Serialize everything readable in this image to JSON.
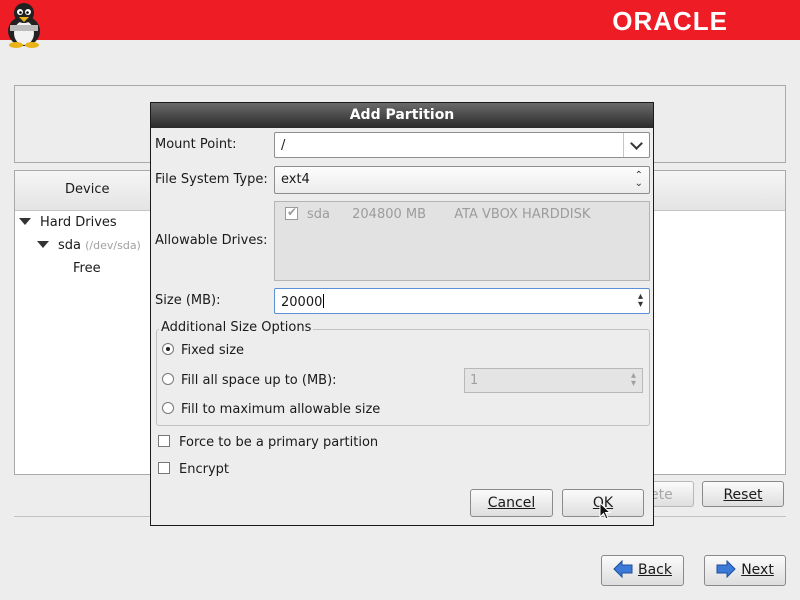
{
  "header": {
    "brand": "ORACLE"
  },
  "background": {
    "tree_header": "Device",
    "tree": [
      {
        "label": "Hard Drives"
      },
      {
        "label": "sda",
        "sub": "(/dev/sda)"
      },
      {
        "label": "Free"
      }
    ],
    "buttons": {
      "delete_partial": "ete",
      "reset": "Reset",
      "back": "Back",
      "next": "Next"
    }
  },
  "dialog": {
    "title": "Add Partition",
    "mount_point_label": "Mount Point:",
    "mount_point_value": "/",
    "fs_type_label": "File System Type:",
    "fs_type_value": "ext4",
    "allowable_drives_label": "Allowable Drives:",
    "drives": [
      {
        "name": "sda",
        "size": "204800 MB",
        "model": "ATA VBOX HARDDISK",
        "checked": true
      }
    ],
    "size_label": "Size (MB):",
    "size_value": "20000",
    "size_options_label": "Additional Size Options",
    "options": {
      "fixed": "Fixed size",
      "fill_upto": "Fill all space up to (MB):",
      "fill_upto_value": "1",
      "fill_max": "Fill to maximum allowable size"
    },
    "primary_label": "Force to be a primary partition",
    "encrypt_label": "Encrypt",
    "cancel_label": "Cancel",
    "ok_label": "OK"
  }
}
